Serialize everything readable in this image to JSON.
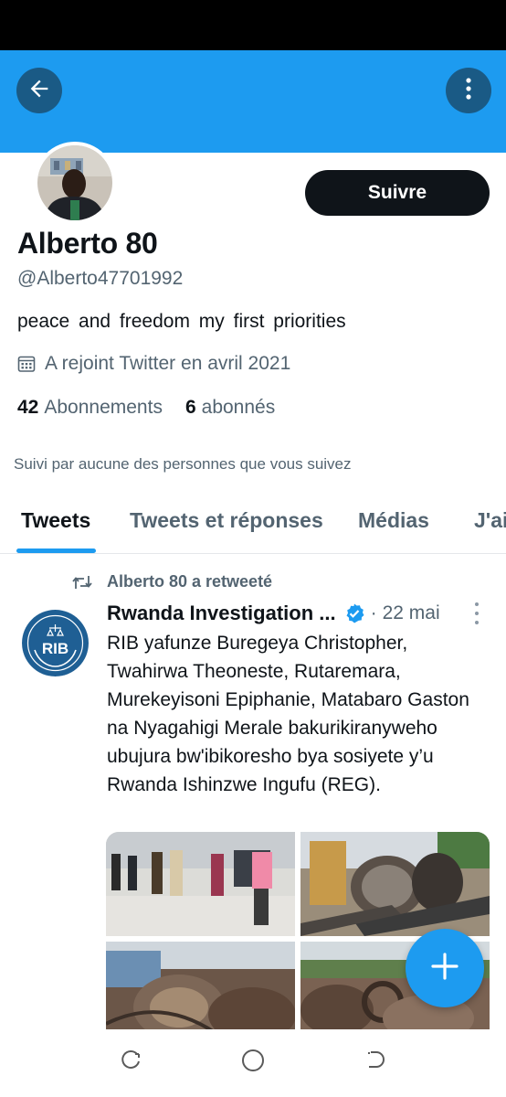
{
  "colors": {
    "accent": "#1d9bf0",
    "text_primary": "#0f1419",
    "text_secondary": "#536471",
    "verified": "#1d9bf0"
  },
  "header": {
    "back_icon": "arrow-left-icon",
    "more_icon": "more-vertical-icon"
  },
  "profile": {
    "follow_label": "Suivre",
    "display_name": "Alberto 80",
    "handle": "@Alberto47701992",
    "bio": "peace and freedom my first priorities",
    "joined": "A rejoint Twitter en avril 2021",
    "following_count": "42",
    "following_label": "Abonnements",
    "followers_count": "6",
    "followers_label": "abonnés",
    "followed_by": "Suivi par aucune des personnes que vous suivez"
  },
  "tabs": [
    {
      "label": "Tweets",
      "active": true
    },
    {
      "label": "Tweets et réponses",
      "active": false
    },
    {
      "label": "Médias",
      "active": false
    },
    {
      "label": "J'ai",
      "active": false
    }
  ],
  "tweet": {
    "retweeted_by": "Alberto 80 a retweeté",
    "author": "Rwanda Investigation ...",
    "separator": "·",
    "date": "22 mai",
    "avatar_text": "RIB",
    "text": "RIB yafunze Buregeya Christopher, Twahirwa Theoneste, Rutaremara, Murekeyisoni Epiphanie, Matabaro Gaston na Nyagahigi Merale bakurikiranyweho ubujura bw'ibikoresho bya sosiyete y’u Rwanda Ishinzwe Ingufu (REG)."
  },
  "fab": {
    "icon": "plus-icon"
  },
  "nav": [
    "recent-apps-icon",
    "home-icon",
    "back-nav-icon"
  ]
}
